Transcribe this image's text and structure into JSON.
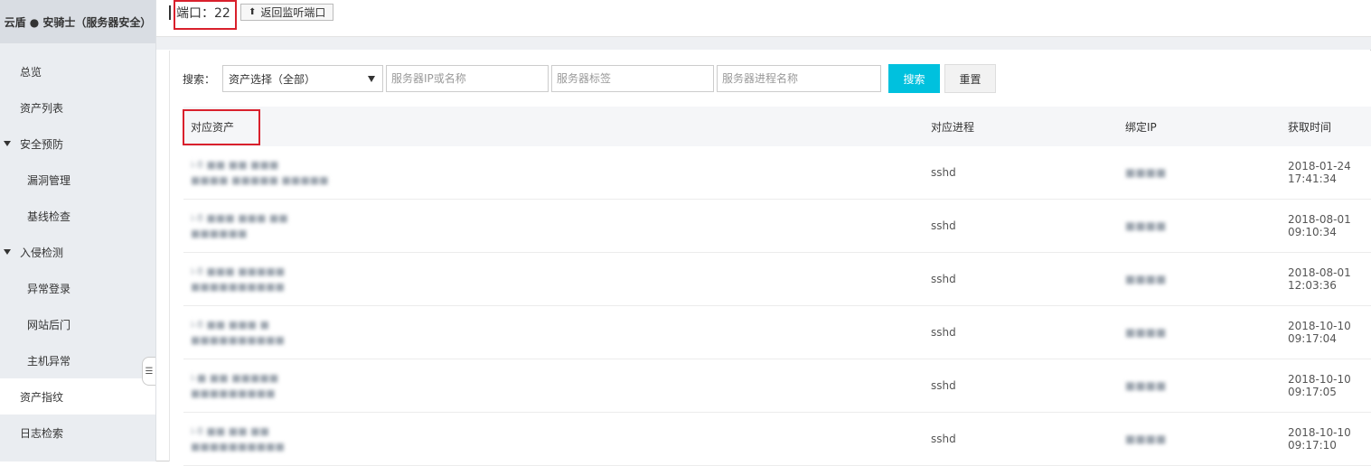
{
  "sidebar": {
    "brand": "云盾 ● 安骑士（服务器安全）",
    "items": [
      {
        "label": "总览",
        "kind": "item"
      },
      {
        "label": "资产列表",
        "kind": "item"
      },
      {
        "label": "安全预防",
        "kind": "group"
      },
      {
        "label": "漏洞管理",
        "kind": "sub"
      },
      {
        "label": "基线检查",
        "kind": "sub"
      },
      {
        "label": "入侵检测",
        "kind": "group"
      },
      {
        "label": "异常登录",
        "kind": "sub"
      },
      {
        "label": "网站后门",
        "kind": "sub"
      },
      {
        "label": "主机异常",
        "kind": "sub"
      },
      {
        "label": "资产指纹",
        "kind": "item",
        "active": true
      },
      {
        "label": "日志检索",
        "kind": "item"
      }
    ]
  },
  "header": {
    "port_title": "端口：22",
    "back_button": "返回监听端口"
  },
  "search": {
    "label": "搜索：",
    "asset_select": "资产选择（全部）",
    "ip_placeholder": "服务器IP或名称",
    "tag_placeholder": "服务器标签",
    "process_placeholder": "服务器进程名称",
    "search_button": "搜索",
    "reset_button": "重置"
  },
  "table": {
    "columns": [
      "对应资产",
      "对应进程",
      "绑定IP",
      "获取时间"
    ],
    "rows": [
      {
        "asset_line1": "i-8 ■■ ■■ ■■■",
        "asset_line2": "■■■■ ■■■■■ ■■■■■",
        "process": "sshd",
        "ip": "■■■■",
        "time": "2018-01-24 17:41:34"
      },
      {
        "asset_line1": "i-8 ■■■ ■■■ ■■",
        "asset_line2": "■■■■■■",
        "process": "sshd",
        "ip": "■■■■",
        "time": "2018-08-01 09:10:34"
      },
      {
        "asset_line1": "i-8 ■■■ ■■■■■",
        "asset_line2": "■■■■■■■■■■",
        "process": "sshd",
        "ip": "■■■■",
        "time": "2018-08-01 12:03:36"
      },
      {
        "asset_line1": "i-8 ■■ ■■■ ■",
        "asset_line2": "■■■■■■■■■■",
        "process": "sshd",
        "ip": "■■■■",
        "time": "2018-10-10 09:17:04"
      },
      {
        "asset_line1": "i-■ ■■ ■■■■■",
        "asset_line2": "■■■■■■■■■",
        "process": "sshd",
        "ip": "■■■■",
        "time": "2018-10-10 09:17:05"
      },
      {
        "asset_line1": "i-8 ■■ ■■ ■■",
        "asset_line2": "■■■■■■■■■■",
        "process": "sshd",
        "ip": "■■■■",
        "time": "2018-10-10 09:17:10"
      }
    ]
  },
  "colors": {
    "accent": "#00c1de",
    "highlight": "#d9202c",
    "sidebar_bg": "#eaedf1"
  }
}
